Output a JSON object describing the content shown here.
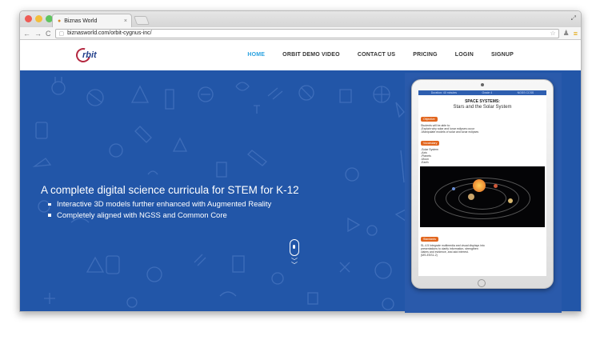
{
  "browser": {
    "tab_title": "Biznas World",
    "tab_close": "×",
    "url": "biznasworld.com/orbit-cygnus-inc/"
  },
  "site": {
    "logo_text": "rbit",
    "nav": [
      "HOME",
      "ORBIT DEMO VIDEO",
      "CONTACT US",
      "PRICING",
      "LOGIN",
      "SIGNUP"
    ],
    "nav_active": "HOME"
  },
  "hero": {
    "headline": "A complete digital science curricula for STEM for K-12",
    "bullets": [
      "Interactive 3D models further enhanced with Augmented Reality",
      "Completely aligned with NGSS and Common Core"
    ]
  },
  "tablet": {
    "bar": [
      "Duration: 40 minutes",
      "Grade 4",
      "NGSS CCSS"
    ],
    "title": "SPACE SYSTEMS:",
    "subtitle": "Stars and the Solar System",
    "objective_tag": "Objective",
    "objective_lines": [
      "Students will be able to:",
      "-Explain why solar and lunar eclipses occur",
      "-Manipulate models of solar and lunar eclipses"
    ],
    "vocab_tag": "Vocabulary",
    "vocab_lines": [
      "-Solar System",
      "-Axis",
      "-Planets",
      "-Moon",
      "-Earth"
    ],
    "standards_tag": "Standards",
    "standards_lines": [
      "SL.4.5  Integrate multimedia and visual displays into",
      "presentations to clarify information, strengthen",
      "claims and evidence, and add interest.",
      "(MS-ESS1-2)"
    ]
  },
  "colors": {
    "hero_bg": "#2256a8",
    "nav_active": "#2aa2e0",
    "tag_orange": "#e2661e"
  }
}
